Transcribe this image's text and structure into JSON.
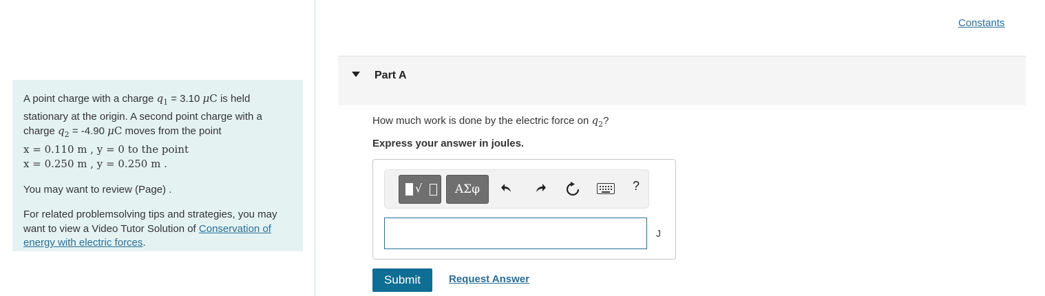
{
  "problem": {
    "p1": {
      "t1": "A point charge with a charge ",
      "q1_sym": "q",
      "q1_sub": "1",
      "t2": " = 3.10 ",
      "mu": "μ",
      "C": "C",
      "t3": " is held stationary at the origin. A second point charge with a charge ",
      "q2_sym": "q",
      "q2_sub": "2",
      "t4": " = -4.90 ",
      "t5": " moves from the point",
      "pt1": "x = 0.110 m , y = 0 to the point",
      "pt2": "x = 0.250 m , y = 0.250 m ."
    },
    "p2": "You may want to review (Page) .",
    "p3_text": "For related problemsolving tips and strategies, you may want to view a Video Tutor Solution of ",
    "p3_link": "Conservation of energy with electric forces",
    "p3_end": "."
  },
  "constants_link": "Constants",
  "part": {
    "title": "Part A",
    "question_before": "How much work is done by the electric force on ",
    "question_sym": "q",
    "question_sub": "2",
    "question_after": "?",
    "instruction": "Express your answer in joules.",
    "toolbar": {
      "greek": "ΑΣφ",
      "undo_icon": "undo-icon",
      "redo_icon": "redo-icon",
      "reset_icon": "reset-icon",
      "keyboard_icon": "keyboard-icon",
      "help": "?"
    },
    "input_value": "",
    "unit": "J",
    "submit": "Submit",
    "request_answer": "Request Answer"
  },
  "colors": {
    "accent": "#0e6e93",
    "link": "#2b6e96",
    "problem_bg": "#e4f3f2"
  }
}
